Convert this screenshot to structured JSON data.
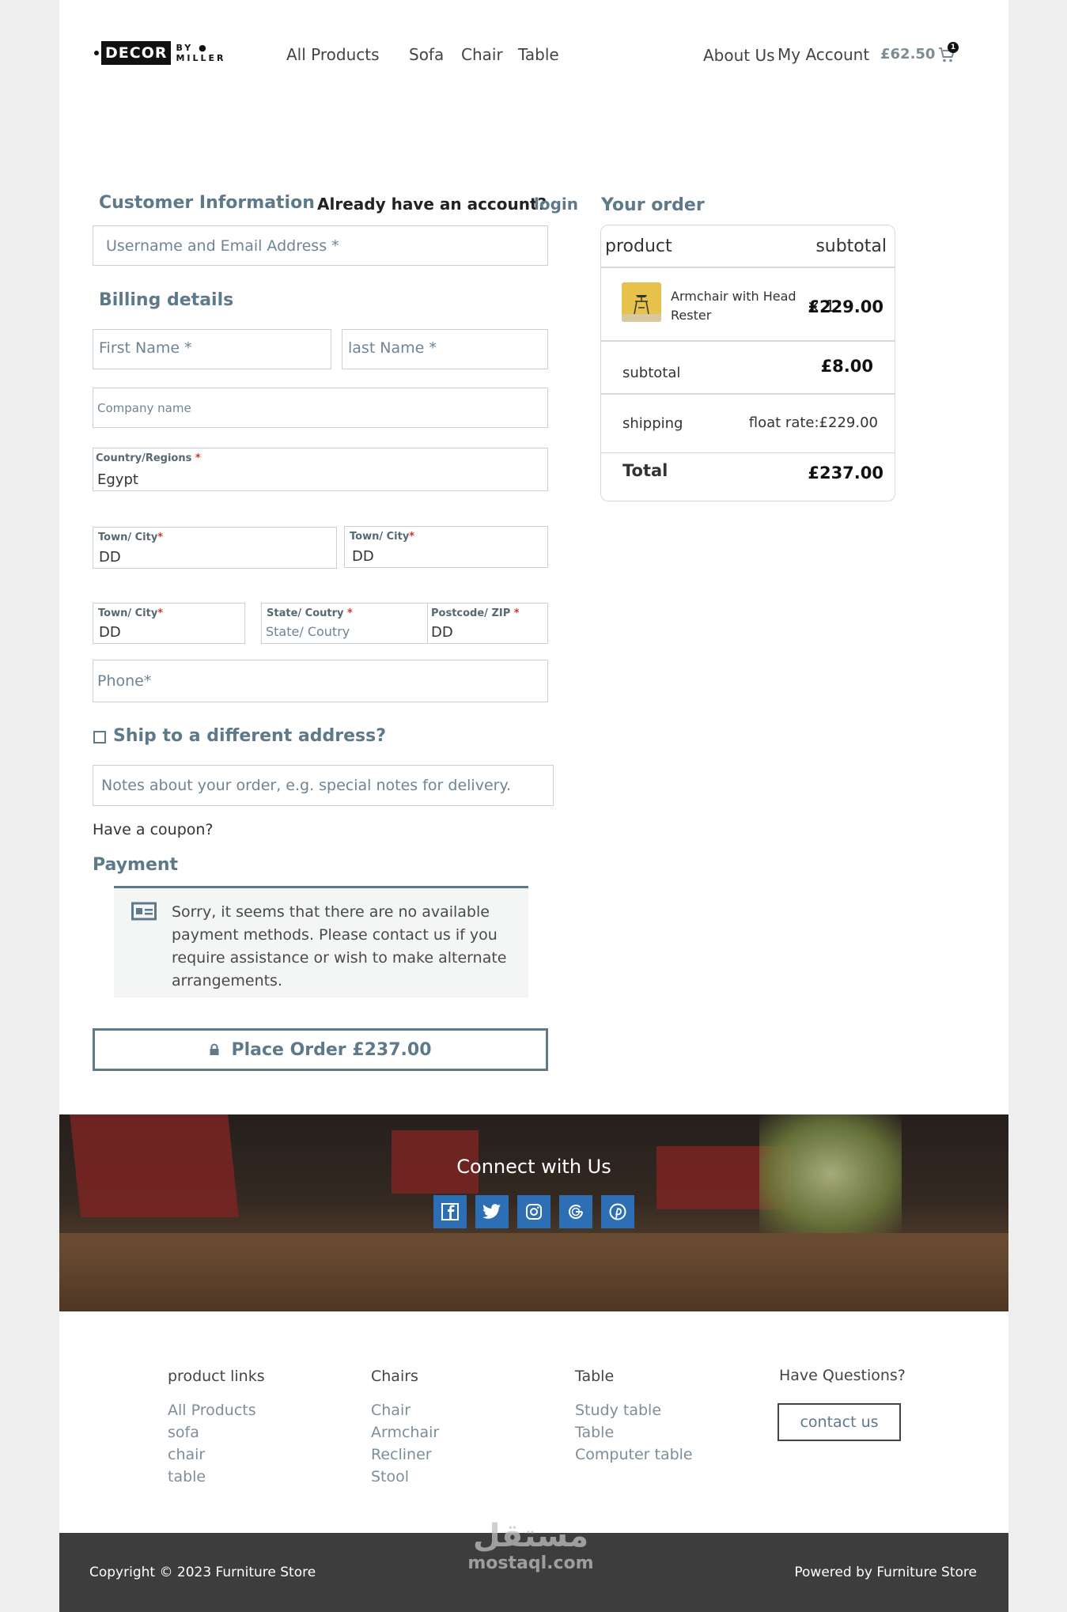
{
  "header": {
    "logo_main": "DECOR",
    "logo_by": "BY",
    "logo_miller": "MILLER",
    "nav": [
      "All Products",
      "Sofa",
      "Chair",
      "Table"
    ],
    "about": "About Us",
    "account": "My Account",
    "cart_total": "£62.50",
    "cart_count": "1"
  },
  "customer": {
    "title": "Customer Information",
    "have_account": "Already have an account?",
    "login": "login",
    "username_placeholder": "Username and Email Address *"
  },
  "billing": {
    "title": "Billing details",
    "first_name": "First Name *",
    "last_name": "last Name *",
    "company": "Company name",
    "country_label": "Country/Regions",
    "country_value": "Egypt",
    "town_label": "Town/ City",
    "town_value": "DD",
    "state_label": "State/ Coutry",
    "state_placeholder": "State/ Coutry",
    "postcode_label": "Postcode/ ZIP",
    "postcode_value": "DD",
    "phone": "Phone*",
    "required_mark": "*"
  },
  "ship": {
    "label": "Ship to a different address?",
    "checked": false
  },
  "notes": {
    "placeholder": "Notes about your order, e.g. special notes for delivery."
  },
  "coupon": "Have a coupon?",
  "payment": {
    "title": "Payment",
    "notice": "Sorry, it seems that there are no available payment methods. Please contact us if you require assistance or wish to make alternate arrangements.",
    "place_order": "Place Order £237.00"
  },
  "order": {
    "title": "Your order",
    "col_product": "product",
    "col_subtotal": "subtotal",
    "item_name": "Armchair with Head Rester",
    "item_qty": "× 1",
    "item_price": "£229.00",
    "subtotal_label": "subtotal",
    "subtotal_value": "£8.00",
    "shipping_label": "shipping",
    "shipping_value": "float rate:£229.00",
    "total_label": "Total",
    "total_value": "£237.00"
  },
  "connect": {
    "title": "Connect with Us",
    "icons": [
      "facebook-icon",
      "twitter-icon",
      "instagram-icon",
      "google-icon",
      "pinterest-icon"
    ]
  },
  "footer": {
    "col1_title": "product links",
    "col1_links": [
      "All Products",
      "sofa",
      "chair",
      "table"
    ],
    "col2_title": "Chairs",
    "col2_links": [
      "Chair",
      "Armchair",
      "Recliner",
      "Stool"
    ],
    "col3_title": "Table",
    "col3_links": [
      "Study table",
      "Table",
      "Computer table"
    ],
    "col4_title": "Have Questions?",
    "contact_button": "contact us",
    "copyright": "Copyright © 2023 Furniture Store",
    "powered": "Powered by Furniture Store",
    "watermark_arabic": "مستقل",
    "watermark_latin": "mostaql.com"
  },
  "colors": {
    "accent": "#5e7a8a",
    "social": "#2d6fb5",
    "footer_bar": "#3d3d3d",
    "required": "#d93025"
  }
}
